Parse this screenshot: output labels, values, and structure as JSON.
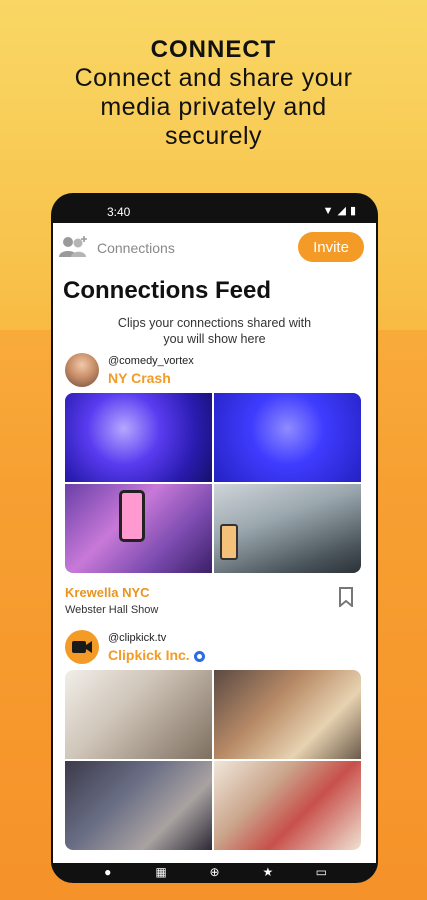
{
  "headline": {
    "title": "CONNECT",
    "line1": "Connect and share your",
    "line2": "media privately and",
    "line3": "securely"
  },
  "status_bar": {
    "time": "3:40"
  },
  "topbar": {
    "section_label": "Connections",
    "invite_label": "Invite"
  },
  "feed": {
    "title": "Connections Feed",
    "subtitle_line1": "Clips your connections shared with",
    "subtitle_line2": "you will show here"
  },
  "posts": [
    {
      "handle": "@comedy_vortex",
      "name": "NY Crash",
      "caption_title": "Krewella NYC",
      "caption_sub": "Webster Hall Show"
    },
    {
      "handle": "@clipkick.tv",
      "name": "Clipkick Inc.",
      "verified": true
    }
  ],
  "colors": {
    "accent": "#f39b26",
    "verified": "#2a6de0"
  },
  "icons": {
    "connections": "people-plus-icon",
    "bookmark": "bookmark-icon",
    "nav": [
      "avatar-icon",
      "feed-icon",
      "add-circle-icon",
      "star-icon",
      "chat-icon"
    ]
  }
}
